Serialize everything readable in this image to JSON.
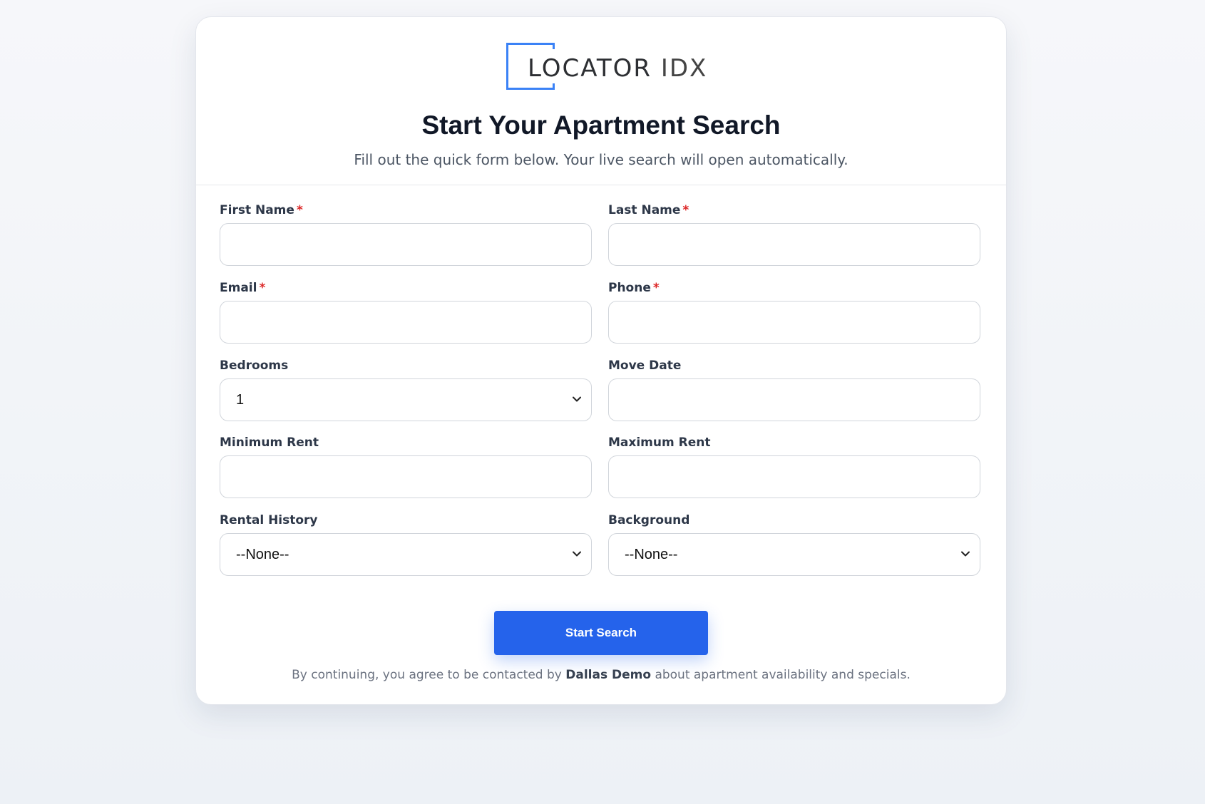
{
  "brand": {
    "logo_main": "LOCATOR",
    "logo_suffix": "IDX",
    "accent_color": "#3b82f6"
  },
  "header": {
    "title": "Start Your Apartment Search",
    "subtitle": "Fill out the quick form below. Your live search will open automatically."
  },
  "form": {
    "required_marker": "*",
    "first_name": {
      "label": "First Name",
      "value": ""
    },
    "last_name": {
      "label": "Last Name",
      "value": ""
    },
    "email": {
      "label": "Email",
      "value": ""
    },
    "phone": {
      "label": "Phone",
      "value": ""
    },
    "bedrooms": {
      "label": "Bedrooms",
      "selected": "1"
    },
    "move_date": {
      "label": "Move Date",
      "value": ""
    },
    "min_rent": {
      "label": "Minimum Rent",
      "value": ""
    },
    "max_rent": {
      "label": "Maximum Rent",
      "value": ""
    },
    "rental_history": {
      "label": "Rental History",
      "selected": "--None--"
    },
    "background": {
      "label": "Background",
      "selected": "--None--"
    },
    "submit_label": "Start Search",
    "submit_color": "#2563eb"
  },
  "disclaimer": {
    "prefix": "By continuing, you agree to be contacted by",
    "company": "Dallas Demo",
    "suffix": "about apartment availability and specials."
  }
}
